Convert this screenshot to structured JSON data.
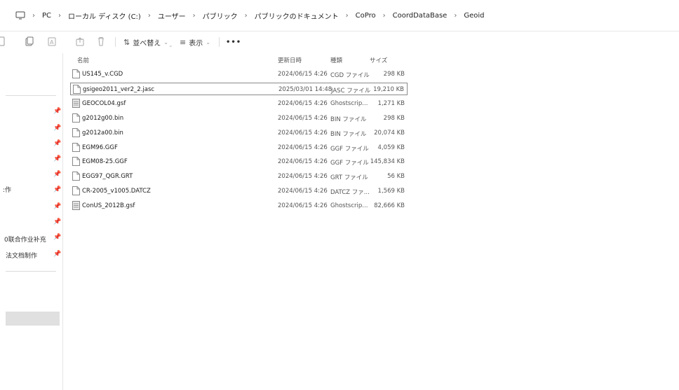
{
  "address": {
    "segments": [
      "PC",
      "ローカル ディスク (C:)",
      "ユーザー",
      "パブリック",
      "パブリックのドキュメント",
      "CoPro",
      "CoordDataBase",
      "Geoid"
    ],
    "separator": "›"
  },
  "toolbar": {
    "sort_label": "並べ替え",
    "view_label": "表示",
    "more_label": "•••"
  },
  "sidebar": {
    "items": [
      {
        "label": ""
      },
      {
        "label": ""
      },
      {
        "label": ""
      },
      {
        "label": ""
      },
      {
        "label": ""
      },
      {
        "label": ":作"
      },
      {
        "label": ""
      },
      {
        "label": ""
      },
      {
        "label": "0联合作业补充"
      },
      {
        "label": "法文档制作"
      }
    ]
  },
  "columns": {
    "name": "名前",
    "date": "更新日時",
    "type": "種類",
    "size": "サイズ"
  },
  "files": [
    {
      "name": "US145_v.CGD",
      "date": "2024/06/15 4:26",
      "type": "CGD ファイル",
      "size": "298 KB",
      "icon": "file-icon"
    },
    {
      "name": "gsigeo2011_ver2_2.jasc",
      "date": "2025/03/01 14:48",
      "type": "JASC ファイル",
      "size": "19,210 KB",
      "icon": "file-icon"
    },
    {
      "name": "GEOCOL04.gsf",
      "date": "2024/06/15 4:26",
      "type": "Ghostscrip...",
      "size": "1,271 KB",
      "icon": "document-icon"
    },
    {
      "name": "g2012g00.bin",
      "date": "2024/06/15 4:26",
      "type": "BIN ファイル",
      "size": "298 KB",
      "icon": "file-icon"
    },
    {
      "name": "g2012a00.bin",
      "date": "2024/06/15 4:26",
      "type": "BIN ファイル",
      "size": "20,074 KB",
      "icon": "file-icon"
    },
    {
      "name": "EGM96.GGF",
      "date": "2024/06/15 4:26",
      "type": "GGF ファイル",
      "size": "4,059 KB",
      "icon": "file-icon"
    },
    {
      "name": "EGM08-25.GGF",
      "date": "2024/06/15 4:26",
      "type": "GGF ファイル",
      "size": "145,834 KB",
      "icon": "file-icon"
    },
    {
      "name": "EGG97_QGR.GRT",
      "date": "2024/06/15 4:26",
      "type": "GRT ファイル",
      "size": "56 KB",
      "icon": "file-icon"
    },
    {
      "name": "CR-2005_v1005.DATCZ",
      "date": "2024/06/15 4:26",
      "type": "DATCZ ファ...",
      "size": "1,569 KB",
      "icon": "file-icon"
    },
    {
      "name": "ConUS_2012B.gsf",
      "date": "2024/06/15 4:26",
      "type": "Ghostscrip...",
      "size": "82,666 KB",
      "icon": "document-icon"
    }
  ],
  "colors": {
    "selected_border": "#8a8a8a",
    "sidebar_selected": "#e0e0e0"
  }
}
